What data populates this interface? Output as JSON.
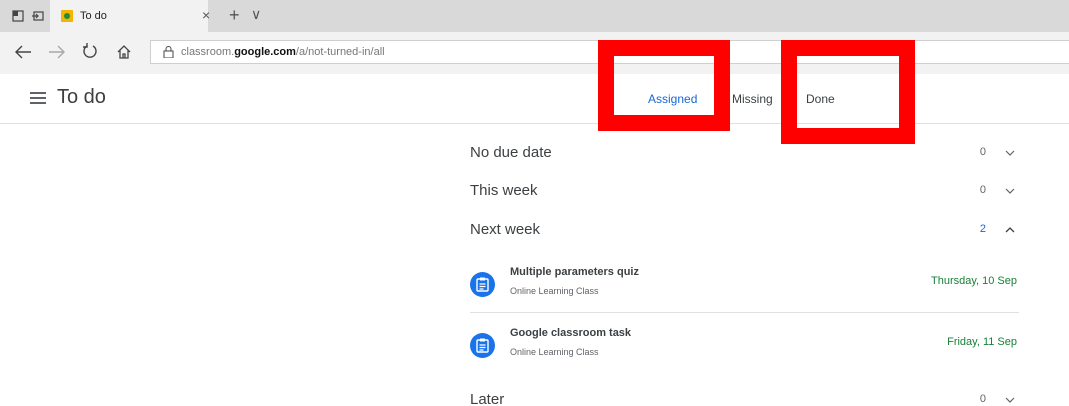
{
  "browser": {
    "tab_title": "To do",
    "tab_close": "×",
    "tab_new": "+",
    "tab_list": "∨",
    "url_prefix": "classroom.",
    "url_domain": "google.com",
    "url_path": "/a/not-turned-in/all",
    "icons": [
      "tab-preview-icon",
      "set-aside-tabs-icon",
      "classroom-favicon",
      "back-icon",
      "forward-icon",
      "refresh-icon",
      "home-icon",
      "lock-icon"
    ]
  },
  "header": {
    "title": "To do",
    "tabs": [
      {
        "label": "Assigned"
      },
      {
        "label": "Missing"
      },
      {
        "label": "Done"
      }
    ],
    "active_tab_color": "#1967d2"
  },
  "sections": [
    {
      "label": "No due date",
      "count": "0"
    },
    {
      "label": "This week",
      "count": "0"
    },
    {
      "label": "Next week",
      "count": "2"
    },
    {
      "label": "Later",
      "count": "0"
    }
  ],
  "items": [
    {
      "title": "Multiple parameters quiz",
      "class": "Online Learning Class",
      "due": "Thursday, 10 Sep"
    },
    {
      "title": "Google classroom task",
      "class": "Online Learning Class",
      "due": "Friday, 11 Sep"
    }
  ],
  "colors": {
    "accent": "#1a73e8",
    "due_green": "#188038",
    "annotation_red": "#ff0000"
  }
}
